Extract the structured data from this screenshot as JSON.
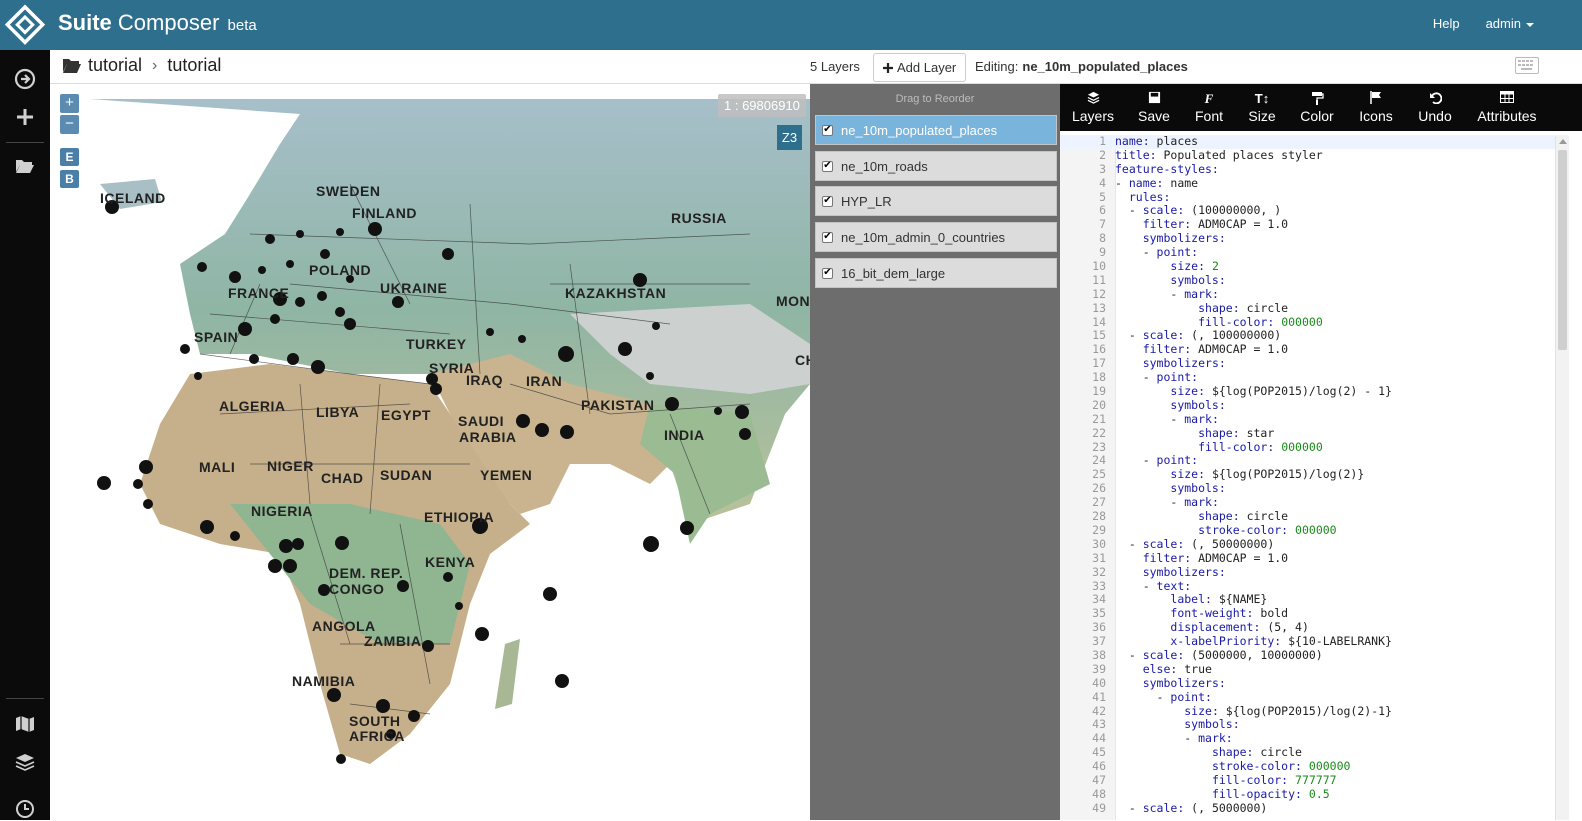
{
  "app": {
    "brand_bold": "Suite",
    "brand_rest": " Composer",
    "badge": "beta"
  },
  "nav": {
    "help": "Help",
    "user": "admin"
  },
  "breadcrumb": {
    "part1": "tutorial",
    "part2": "tutorial"
  },
  "toolbar_top": {
    "layers_count": "5 Layers",
    "add_layer": "Add Layer",
    "editing_label": "Editing:",
    "editing_layer": "ne_10m_populated_places"
  },
  "map": {
    "zoom_in": "+",
    "zoom_out": "−",
    "btn_e": "E",
    "btn_b": "B",
    "scale": "1 : 69806910",
    "zoom_level": "Z3",
    "labels": [
      "ICELAND",
      "SWEDEN",
      "FINLAND",
      "RUSSIA",
      "POLAND",
      "UKRAINE",
      "FRANCE",
      "KAZAKHSTAN",
      "MON",
      "SPAIN",
      "TURKEY",
      "SYRIA",
      "IRAQ",
      "IRAN",
      "CH",
      "ALGERIA",
      "LIBYA",
      "EGYPT",
      "SAUDI",
      "ARABIA",
      "PAKISTAN",
      "INDIA",
      "MALI",
      "NIGER",
      "CHAD",
      "SUDAN",
      "YEMEN",
      "NIGERIA",
      "ETHIOPIA",
      "KENYA",
      "DEM. REP.",
      "CONGO",
      "ANGOLA",
      "ZAMBIA",
      "NAMIBIA",
      "SOUTH",
      "AFRICA"
    ]
  },
  "layers_panel": {
    "hint": "Drag to Reorder",
    "layers": [
      {
        "name": "ne_10m_populated_places",
        "checked": true,
        "active": true
      },
      {
        "name": "ne_10m_roads",
        "checked": true,
        "active": false
      },
      {
        "name": "HYP_LR",
        "checked": true,
        "active": false
      },
      {
        "name": "ne_10m_admin_0_countries",
        "checked": true,
        "active": false
      },
      {
        "name": "16_bit_dem_large",
        "checked": true,
        "active": false
      }
    ]
  },
  "editor": {
    "tools": [
      {
        "label": "Layers",
        "icon": "layers-icon"
      },
      {
        "label": "Save",
        "icon": "save-icon"
      },
      {
        "label": "Font",
        "icon": "font-icon"
      },
      {
        "label": "Size",
        "icon": "size-icon"
      },
      {
        "label": "Color",
        "icon": "paint-roller-icon"
      },
      {
        "label": "Icons",
        "icon": "flag-icon"
      },
      {
        "label": "Undo",
        "icon": "undo-icon"
      },
      {
        "label": "Attributes",
        "icon": "table-icon"
      }
    ],
    "lines": [
      "name: places",
      "title: Populated places styler",
      "feature-styles:",
      "- name: name",
      "  rules:",
      "  - scale: (100000000, )",
      "    filter: ADM0CAP = 1.0",
      "    symbolizers:",
      "    - point:",
      "        size: 2",
      "        symbols:",
      "        - mark:",
      "            shape: circle",
      "            fill-color: 000000",
      "  - scale: (, 100000000)",
      "    filter: ADM0CAP = 1.0",
      "    symbolizers:",
      "    - point:",
      "        size: ${log(POP2015)/log(2) - 1}",
      "        symbols:",
      "        - mark:",
      "            shape: star",
      "            fill-color: 000000",
      "    - point:",
      "        size: ${log(POP2015)/log(2)}",
      "        symbols:",
      "        - mark:",
      "            shape: circle",
      "            stroke-color: 000000",
      "  - scale: (, 50000000)",
      "    filter: ADM0CAP = 1.0",
      "    symbolizers:",
      "    - text:",
      "        label: ${NAME}",
      "        font-weight: bold",
      "        displacement: (5, 4)",
      "        x-labelPriority: ${10-LABELRANK}",
      "  - scale: (5000000, 10000000)",
      "    else: true",
      "    symbolizers:",
      "      - point:",
      "          size: ${log(POP2015)/log(2)-1}",
      "          symbols:",
      "          - mark:",
      "              shape: circle",
      "              stroke-color: 000000",
      "              fill-color: 777777",
      "              fill-opacity: 0.5",
      "  - scale: (, 5000000)"
    ]
  },
  "colors": {
    "topbar": "#2f6f8e",
    "sidebar": "#0b0b0b",
    "active_layer": "#79b4dc",
    "key": "#1a1aa6",
    "number": "#1a8a1a"
  }
}
